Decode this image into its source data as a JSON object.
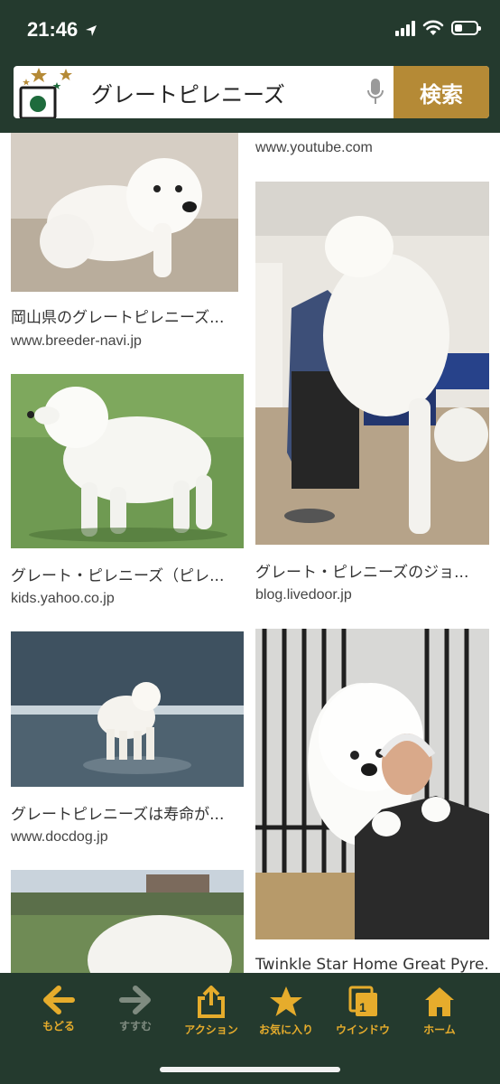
{
  "status_bar": {
    "time": "21:46"
  },
  "search": {
    "query": "グレートピレニーズ",
    "button_label": "検索"
  },
  "results": [
    {
      "title": "",
      "source": "www.youtube.com"
    },
    {
      "title": "岡山県のグレートピレニーズ...",
      "source": "www.breeder-navi.jp"
    },
    {
      "title": "グレート・ピレニーズ（ピレ...",
      "source": "kids.yahoo.co.jp"
    },
    {
      "title": "グレート・ピレニーズのジョ...",
      "source": "blog.livedoor.jp"
    },
    {
      "title": "グレートピレニーズは寿命が...",
      "source": "www.docdog.jp"
    },
    {
      "title": "Twinkle Star Home Great Pyre...",
      "source": ""
    }
  ],
  "toolbar": {
    "back": "もどる",
    "forward": "すすむ",
    "action": "アクション",
    "favorites": "お気に入り",
    "windows": "ウインドウ",
    "windows_count": "1",
    "home": "ホーム"
  },
  "colors": {
    "header_bg": "#243a2e",
    "search_button": "#b58a36",
    "toolbar_icon": "#e6ac2c",
    "toolbar_disabled": "#7f8b80"
  },
  "icons": [
    "location-arrow-icon",
    "signal-icon",
    "wifi-icon",
    "battery-icon",
    "microphone-icon",
    "back-arrow-icon",
    "forward-arrow-icon",
    "share-icon",
    "star-icon",
    "windows-icon",
    "home-icon"
  ]
}
